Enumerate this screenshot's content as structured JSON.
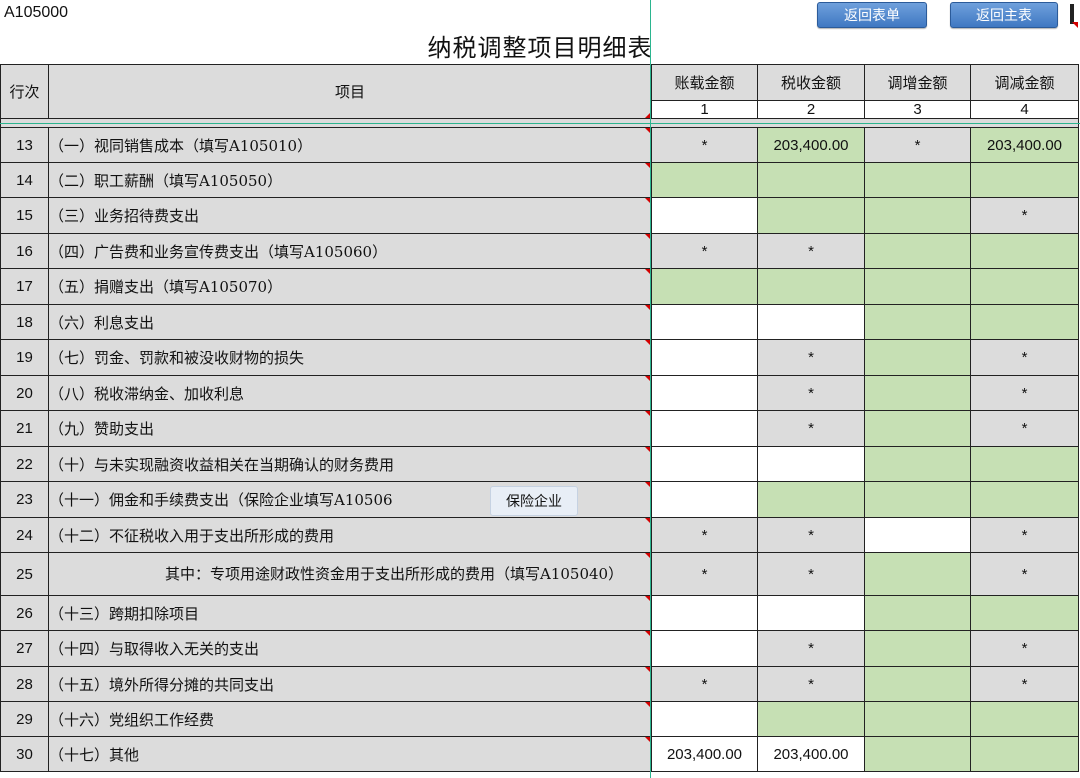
{
  "sheet_id": "A105000",
  "title": "纳税调整项目明细表",
  "buttons": {
    "back_list": "返回表单",
    "back_main": "返回主表"
  },
  "header": {
    "row_label": "行次",
    "item_label": "项目",
    "columns": [
      "账载金额",
      "税收金额",
      "调增金额",
      "调减金额"
    ],
    "column_numbers": [
      "1",
      "2",
      "3",
      "4"
    ]
  },
  "tooltip": "保险企业",
  "rows": [
    {
      "n": "13",
      "item": "（一）视同销售成本（填写A105010）",
      "c": [
        "*",
        "203,400.00",
        "*",
        "203,400.00"
      ]
    },
    {
      "n": "14",
      "item": "（二）职工薪酬（填写A105050）",
      "c": [
        "",
        "",
        "",
        ""
      ]
    },
    {
      "n": "15",
      "item": "（三）业务招待费支出",
      "c": [
        "",
        "",
        "",
        "*"
      ]
    },
    {
      "n": "16",
      "item": "（四）广告费和业务宣传费支出（填写A105060）",
      "c": [
        "*",
        "*",
        "",
        ""
      ]
    },
    {
      "n": "17",
      "item": "（五）捐赠支出（填写A105070）",
      "c": [
        "",
        "",
        "",
        ""
      ]
    },
    {
      "n": "18",
      "item": "（六）利息支出",
      "c": [
        "",
        "",
        "",
        ""
      ]
    },
    {
      "n": "19",
      "item": "（七）罚金、罚款和被没收财物的损失",
      "c": [
        "",
        "*",
        "",
        "*"
      ]
    },
    {
      "n": "20",
      "item": "（八）税收滞纳金、加收利息",
      "c": [
        "",
        "*",
        "",
        "*"
      ]
    },
    {
      "n": "21",
      "item": "（九）赞助支出",
      "c": [
        "",
        "*",
        "",
        "*"
      ]
    },
    {
      "n": "22",
      "item": "（十）与未实现融资收益相关在当期确认的财务费用",
      "c": [
        "",
        "",
        "",
        ""
      ]
    },
    {
      "n": "23",
      "item": "（十一）佣金和手续费支出（保险企业填写A10506",
      "c": [
        "",
        "",
        "",
        ""
      ]
    },
    {
      "n": "24",
      "item": "（十二）不征税收入用于支出所形成的费用",
      "c": [
        "*",
        "*",
        "",
        "*"
      ]
    },
    {
      "n": "25",
      "item": "其中：专项用途财政性资金用于支出所形成的费用（填写A105040）",
      "c": [
        "*",
        "*",
        "",
        "*"
      ]
    },
    {
      "n": "26",
      "item": "（十三）跨期扣除项目",
      "c": [
        "",
        "",
        "",
        ""
      ]
    },
    {
      "n": "27",
      "item": "（十四）与取得收入无关的支出",
      "c": [
        "",
        "*",
        "",
        "*"
      ]
    },
    {
      "n": "28",
      "item": "（十五）境外所得分摊的共同支出",
      "c": [
        "*",
        "*",
        "",
        "*"
      ]
    },
    {
      "n": "29",
      "item": "（十六）党组织工作经费",
      "c": [
        "",
        "",
        "",
        ""
      ]
    },
    {
      "n": "30",
      "item": "（十七）其他",
      "c": [
        "203,400.00",
        "203,400.00",
        "",
        ""
      ]
    }
  ]
}
